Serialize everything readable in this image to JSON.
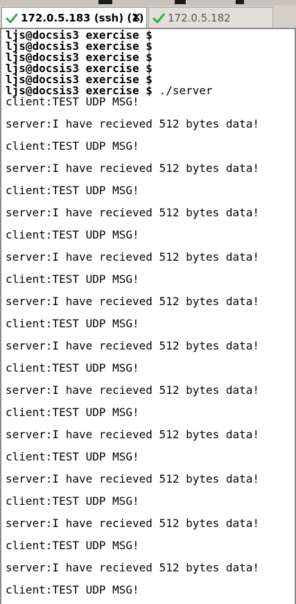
{
  "tabs": [
    {
      "label": "172.0.5.183 (ssh) (1)",
      "active": true,
      "close_glyph": "×"
    },
    {
      "label": "172.0.5.182",
      "active": false
    }
  ],
  "terminal": {
    "prompt": "ljs@docsis3 exercise $",
    "command": "./server",
    "empty_prompt_count": 5,
    "client_msg": "client:TEST UDP MSG!",
    "server_msg": "server:I have recieved 512 bytes data!",
    "exchange_count": 12
  },
  "colors": {
    "check_green": "#3aa83a",
    "tab_bg": "#d4d0c8",
    "terminal_bg": "#ffffff",
    "text": "#000000"
  }
}
